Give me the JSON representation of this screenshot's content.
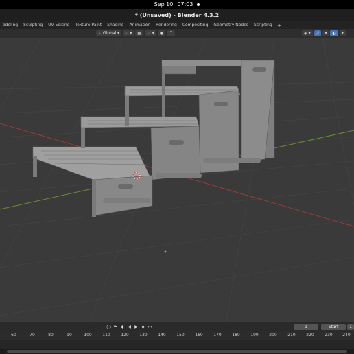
{
  "system_bar": {
    "date": "Sep 10",
    "time": "07:03"
  },
  "window": {
    "title": "* (Unsaved) - Blender 4.3.2"
  },
  "workspace_tabs": [
    "odeling",
    "Sculpting",
    "UV Editing",
    "Texture Paint",
    "Shading",
    "Animation",
    "Rendering",
    "Compositing",
    "Geometry Nodes",
    "Scripting"
  ],
  "workspace_add": "+",
  "viewport_header": {
    "transform_orientation": "Global"
  },
  "timeline": {
    "current_frame": "1",
    "start_label": "Start",
    "start_value": "1",
    "ruler_ticks": [
      "60",
      "70",
      "80",
      "90",
      "100",
      "110",
      "120",
      "130",
      "140",
      "150",
      "160",
      "170",
      "180",
      "190",
      "200",
      "210",
      "220",
      "230",
      "240"
    ]
  },
  "colors": {
    "viewport_bg": "#3a3a3a",
    "grid": "#444444",
    "x_axis": "#9a3b3b",
    "y_axis": "#6b8f2e",
    "model": "#8a8a8a"
  },
  "icons": [
    "orientation-icon",
    "pivot-icon",
    "snap-icon",
    "proportional-icon",
    "visibility-icon",
    "gizmo-icon",
    "overlay-icon",
    "xray-icon",
    "play-icon",
    "jump-start-icon",
    "keyframe-prev-icon",
    "play-reverse-icon",
    "keyframe-next-icon",
    "jump-end-icon",
    "record-icon"
  ]
}
